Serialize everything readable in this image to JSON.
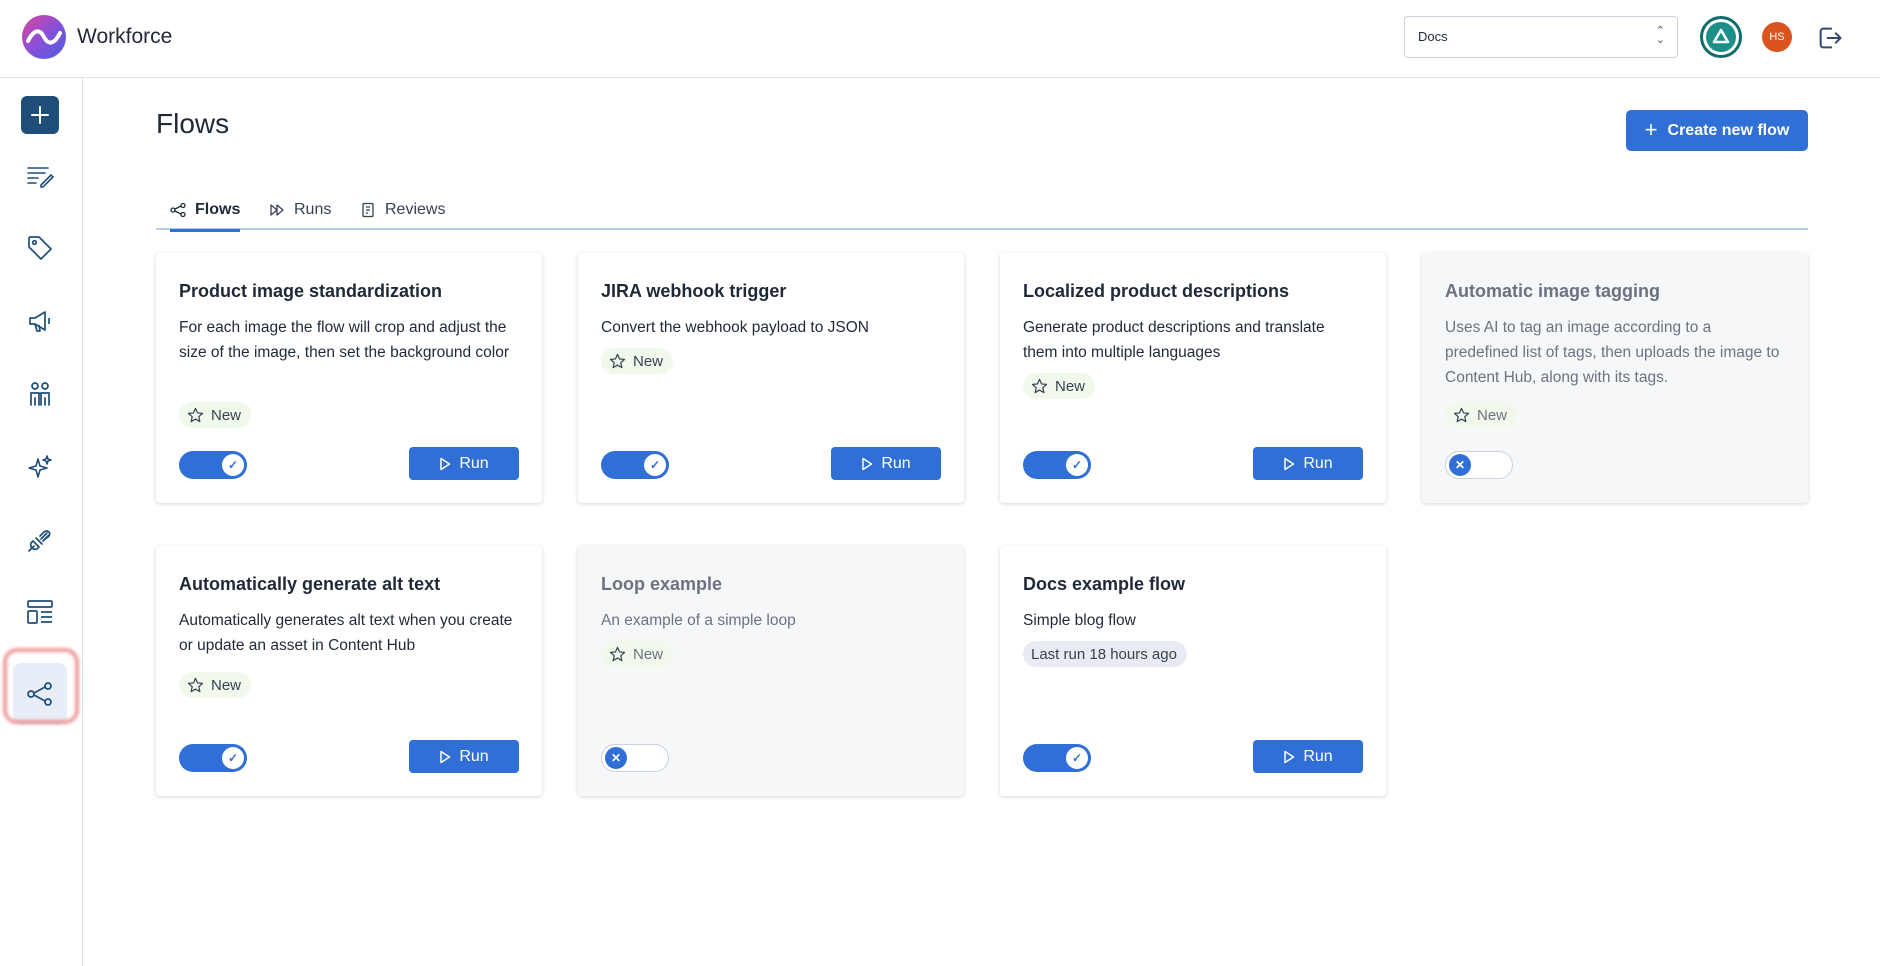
{
  "app": {
    "name": "Workforce"
  },
  "header": {
    "project_select": "Docs",
    "user_initials": "HS"
  },
  "page": {
    "title": "Flows",
    "create_button": "Create new flow"
  },
  "tabs": [
    {
      "label": "Flows",
      "icon": "flow-icon",
      "active": true
    },
    {
      "label": "Runs",
      "icon": "fast-forward-icon",
      "active": false
    },
    {
      "label": "Reviews",
      "icon": "review-icon",
      "active": false
    }
  ],
  "sidebar": {
    "items": [
      "add-icon",
      "edit-list-icon",
      "tag-icon",
      "megaphone-icon",
      "people-icon",
      "sparkles-icon",
      "plug-icon",
      "layout-icon",
      "flow-icon"
    ],
    "active": "flow-icon"
  },
  "cards": [
    {
      "title": "Product image standardization",
      "description": "For each image the flow will crop and adjust the size of the image, then set the background color",
      "badge": "New",
      "enabled": true,
      "run_label": "Run"
    },
    {
      "title": "JIRA webhook trigger",
      "description": "Convert the webhook payload to JSON",
      "badge": "New",
      "enabled": true,
      "run_label": "Run"
    },
    {
      "title": "Localized product descriptions",
      "description": "Generate product descriptions and translate them into multiple languages",
      "badge": "New",
      "enabled": true,
      "run_label": "Run"
    },
    {
      "title": "Automatic image tagging",
      "description": "Uses AI to tag an image according to a predefined list of tags, then uploads the image to Content Hub, along with its tags.",
      "badge": "New",
      "enabled": false
    },
    {
      "title": "Automatically generate alt text",
      "description": "Automatically generates alt text when you create or update an asset in Content Hub",
      "badge": "New",
      "enabled": true,
      "run_label": "Run"
    },
    {
      "title": "Loop example",
      "description": "An example of a simple loop",
      "badge": "New",
      "enabled": false
    },
    {
      "title": "Docs example flow",
      "description": "Simple blog flow",
      "badge": "Last run 18 hours ago",
      "enabled": true,
      "run_label": "Run"
    }
  ],
  "colors": {
    "primary": "#2f6fd6",
    "sidebar_add": "#1f4e79",
    "highlight": "#e87979"
  }
}
